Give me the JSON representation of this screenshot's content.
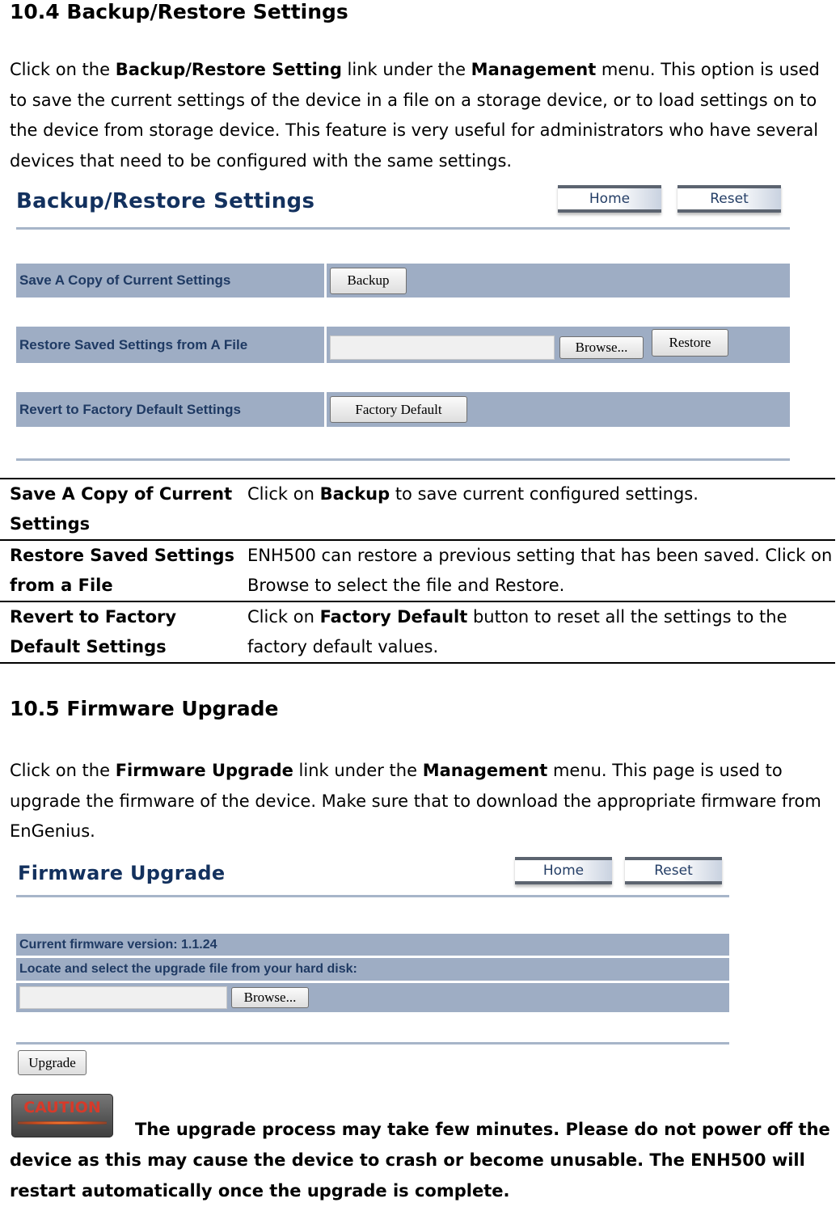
{
  "section1": {
    "heading": "10.4 Backup/Restore Settings",
    "intro": {
      "p1": "Click on the ",
      "b1": "Backup/Restore Setting",
      "p2": " link under the ",
      "b2": "Management",
      "p3": " menu. This option is used to save the current settings of the device in a file on a storage device, or to load settings on to the device from storage device. This feature is very useful for administrators who have several devices that need to be configured with the same settings."
    },
    "ui": {
      "title": "Backup/Restore Settings",
      "home_button": "Home",
      "reset_button": "Reset",
      "rows": [
        {
          "label": "Save A Copy of Current Settings",
          "button": "Backup"
        },
        {
          "label": "Restore Saved Settings from A File",
          "file_value": "",
          "browse_button": "Browse...",
          "button": "Restore"
        },
        {
          "label": "Revert to Factory Default Settings",
          "button": "Factory Default"
        }
      ]
    },
    "table": [
      {
        "key": "Save A Copy of Current Settings",
        "pre": "Click on ",
        "bold": "Backup",
        "post": " to save current configured settings."
      },
      {
        "key": "Restore Saved Settings from a File",
        "pre": "ENH500 can restore a previous setting that has been saved. Click on Browse to select the file and Restore.",
        "bold": "",
        "post": ""
      },
      {
        "key": "Revert to Factory Default Settings",
        "pre": "Click on ",
        "bold": "Factory Default",
        "post": " button to reset all the settings to the factory default values."
      }
    ]
  },
  "section2": {
    "heading": "10.5 Firmware Upgrade",
    "intro": {
      "p1": "Click on the ",
      "b1": "Firmware Upgrade",
      "p2": " link under the ",
      "b2": "Management",
      "p3": " menu. This page is used to upgrade the firmware of the device. Make sure that to download the appropriate firmware from EnGenius."
    },
    "ui": {
      "title": "Firmware Upgrade",
      "home_button": "Home",
      "reset_button": "Reset",
      "version_label": "Current firmware version: 1.1.24",
      "locate_label": "Locate and select the upgrade file from your hard disk:",
      "file_value": "",
      "browse_button": "Browse...",
      "upgrade_button": "Upgrade"
    },
    "caution": {
      "badge": "CAUTION",
      "text": "The upgrade process may take few minutes. Please do not power off the device as this may cause the device to crash or become unusable. The ENH500 will restart automatically once the upgrade is complete."
    }
  }
}
